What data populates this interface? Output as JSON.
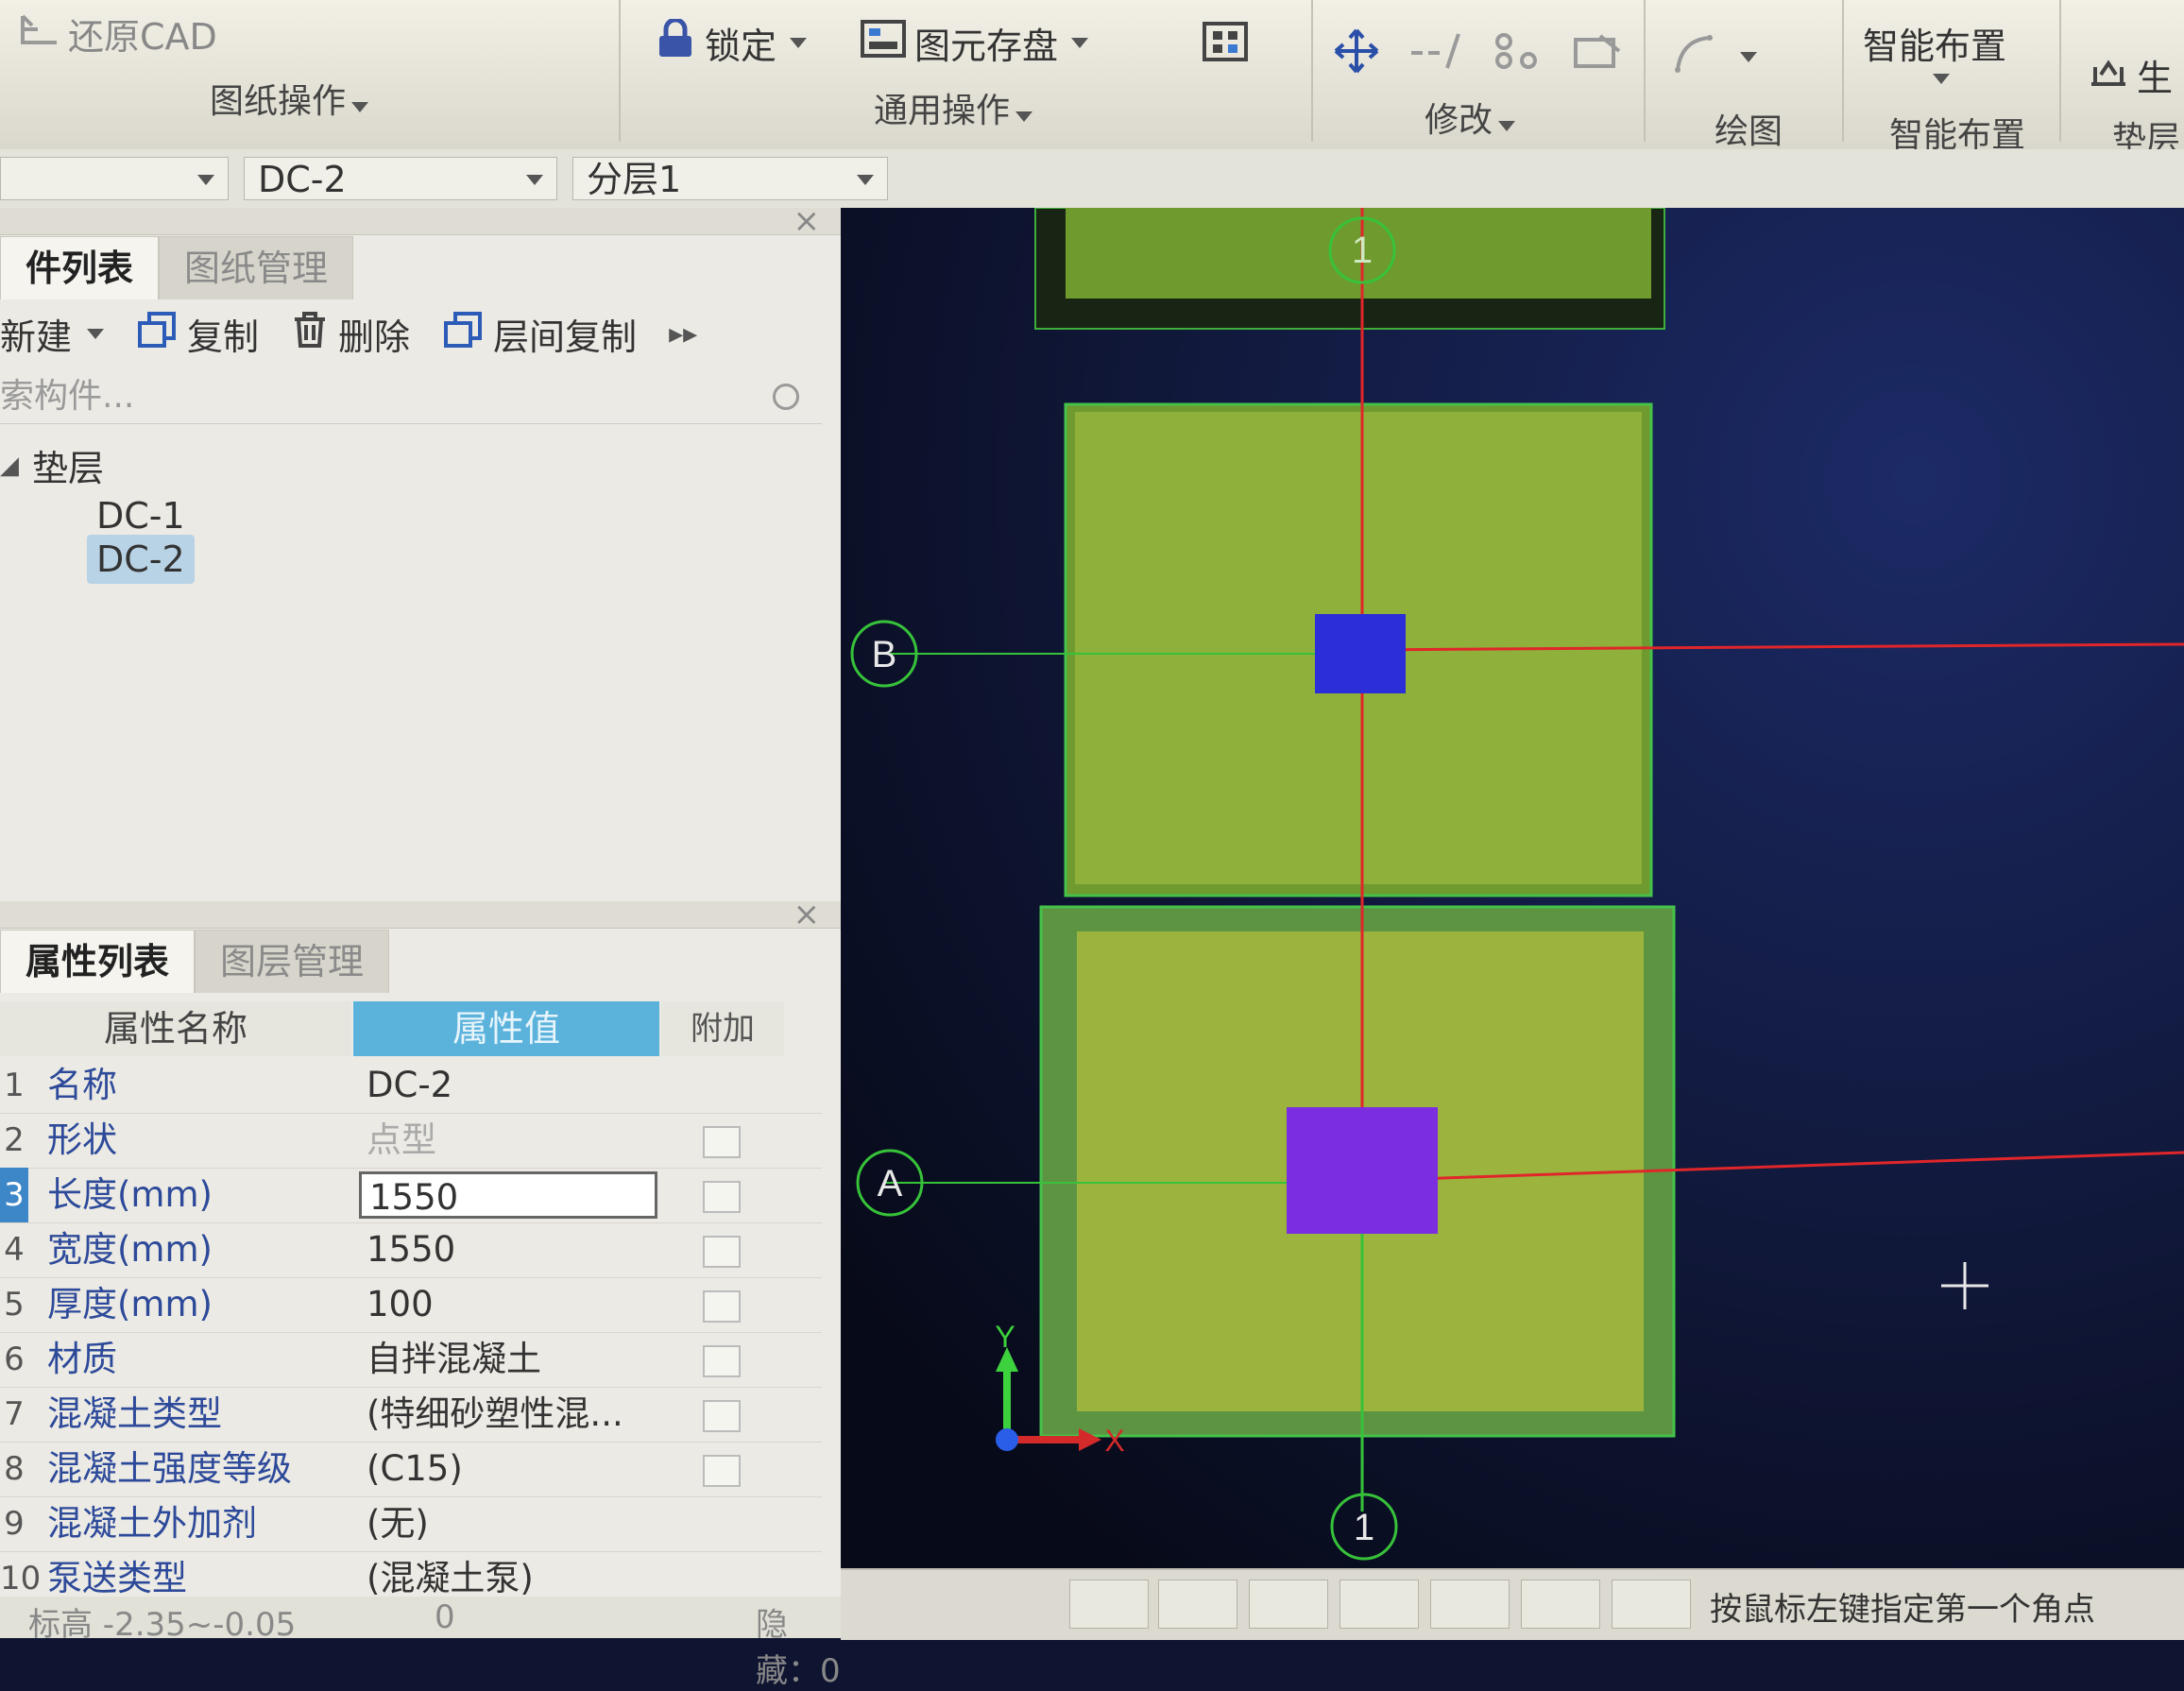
{
  "ribbon": {
    "restore_cad": "还原CAD",
    "drawing_ops": "图纸操作",
    "lock": "锁定",
    "element_save": "图元存盘",
    "common_ops": "通用操作",
    "modify": "修改",
    "draw": "绘图",
    "smart_layout_btn": "智能布置",
    "smart_layout_group": "智能布置",
    "generate": "生",
    "cushion_group": "垫层"
  },
  "selectors": {
    "type_value": "",
    "component_value": "DC-2",
    "sublayer_value": "分层1"
  },
  "component_panel": {
    "tab_list": "件列表",
    "tab_drawings": "图纸管理",
    "new_btn": "新建",
    "copy_btn": "复制",
    "delete_btn": "删除",
    "floor_copy_btn": "层间复制",
    "search_placeholder": "索构件...",
    "group_name": "垫层",
    "items": [
      "DC-1",
      "DC-2"
    ]
  },
  "property_panel": {
    "tab_props": "属性列表",
    "tab_layers": "图层管理",
    "col_name": "属性名称",
    "col_value": "属性值",
    "col_extra": "附加",
    "rows": [
      {
        "num": "1",
        "name": "名称",
        "value": "DC-2"
      },
      {
        "num": "2",
        "name": "形状",
        "value": "点型"
      },
      {
        "num": "3",
        "name": "长度(mm)",
        "value": "1550"
      },
      {
        "num": "4",
        "name": "宽度(mm)",
        "value": "1550"
      },
      {
        "num": "5",
        "name": "厚度(mm)",
        "value": "100"
      },
      {
        "num": "6",
        "name": "材质",
        "value": "自拌混凝土"
      },
      {
        "num": "7",
        "name": "混凝土类型",
        "value": "(特细砂塑性混..."
      },
      {
        "num": "8",
        "name": "混凝土强度等级",
        "value": "(C15)"
      },
      {
        "num": "9",
        "name": "混凝土外加剂",
        "value": "(无)"
      },
      {
        "num": "10",
        "name": "泵送类型",
        "value": "(混凝土泵)"
      }
    ],
    "bottom_partial": "标高  -2.35~-0.05",
    "bottom_partial_value": "0"
  },
  "canvas": {
    "axis_top": "1",
    "axis_bottom": "1",
    "axis_b": "B",
    "axis_a": "A",
    "ucs_y": "Y",
    "ucs_x": "X"
  },
  "status": {
    "hidden_label": "隐藏：0",
    "prompt": "按鼠标左键指定第一个角点"
  },
  "colors": {
    "canvas_bg": "#0f1531",
    "footing_fill": "#8fb03a",
    "column_blue": "#2c2fd8",
    "column_purple": "#7a2ee0",
    "axis_red": "#e0262a",
    "axis_green": "#37c23a"
  }
}
